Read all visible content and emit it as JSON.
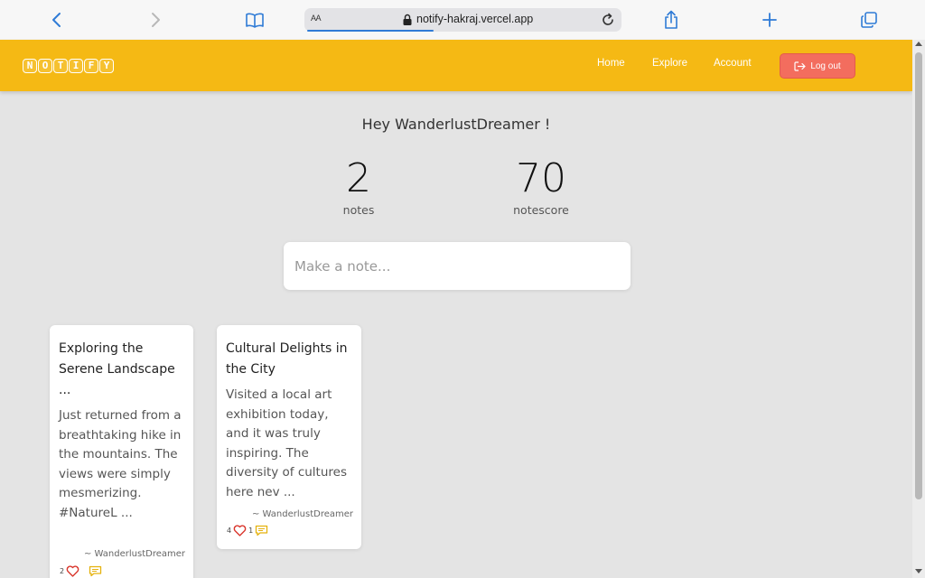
{
  "browser": {
    "address_aa": "AA",
    "url": "notify-hakraj.vercel.app",
    "icons": [
      "back-icon",
      "forward-icon",
      "bookmarks-icon",
      "lock-icon",
      "reload-icon",
      "share-icon",
      "new-tab-icon",
      "tabs-icon"
    ]
  },
  "header": {
    "logo_letters": [
      "N",
      "O",
      "T",
      "I",
      "F",
      "Y"
    ],
    "nav": {
      "home": "Home",
      "explore": "Explore",
      "account": "Account"
    },
    "logout_label": "Log out",
    "accent_color": "#f5b914",
    "logout_color": "#f36d5e"
  },
  "main": {
    "greeting": "Hey WanderlustDreamer !",
    "stats": {
      "notes_value": "2",
      "notes_label": "notes",
      "score_value": "70",
      "score_label": "notescore"
    },
    "note_input_placeholder": "Make a note..."
  },
  "notes": [
    {
      "title": "Exploring the Serene Landscape ...",
      "body": "Just returned from a breathtaking hike in the mountains. The views were simply mesmerizing. #NatureL ...",
      "author": "~ WanderlustDreamer",
      "likes": "2",
      "comments": ""
    },
    {
      "title": "Cultural Delights in the City",
      "body": "Visited a local art exhibition today, and it was truly inspiring. The diversity of cultures here nev ...",
      "author": "~ WanderlustDreamer",
      "likes": "4",
      "comments": "1"
    }
  ]
}
